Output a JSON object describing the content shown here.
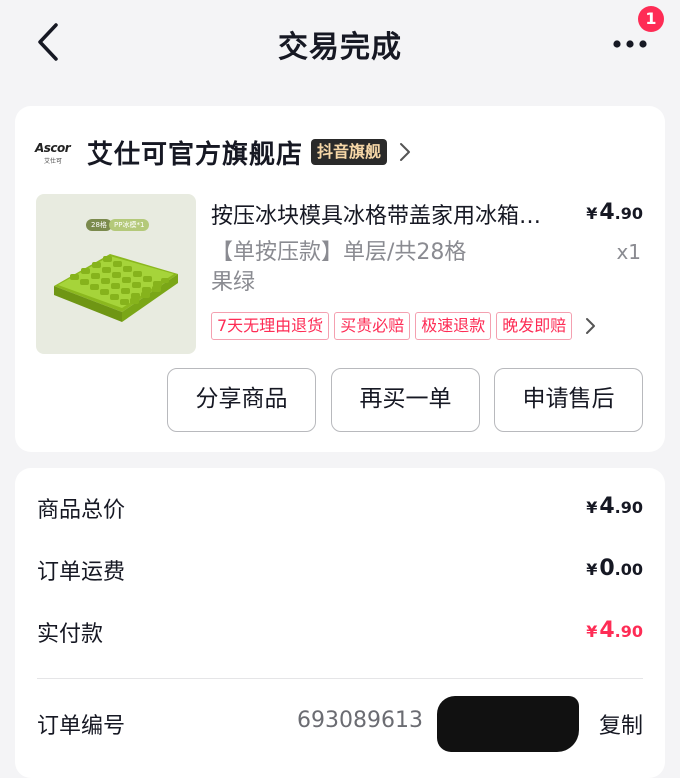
{
  "header": {
    "title": "交易完成",
    "notification_count": "1",
    "icons": [
      "back-arrow-icon",
      "more-dots-icon"
    ]
  },
  "shop": {
    "logo_text": "Ascor",
    "logo_subtext": "艾仕可",
    "name": "艾仕可官方旗舰店",
    "tag": "抖音旗舰"
  },
  "product": {
    "image_labels": [
      "28格",
      "PP冰模*1"
    ],
    "title": "按压冰块模具冰格带盖家用冰箱冻冰块",
    "price_yen": "¥",
    "price_int": "4",
    "price_frac": ".90",
    "spec_line1": "【单按压款】单层/共28格",
    "spec_line2": "果绿",
    "quantity": "x1",
    "service_tags": [
      "7天无理由退货",
      "买贵必赔",
      "极速退款",
      "晚发即赔"
    ]
  },
  "actions": {
    "share": "分享商品",
    "rebuy": "再买一单",
    "after_sale": "申请售后"
  },
  "summary": {
    "total_label": "商品总价",
    "total": {
      "yen": "¥",
      "int": "4",
      "frac": ".90"
    },
    "shipping_label": "订单运费",
    "shipping": {
      "yen": "¥",
      "int": "0",
      "frac": ".00"
    },
    "paid_label": "实付款",
    "paid": {
      "yen": "¥",
      "int": "4",
      "frac": ".90"
    },
    "order_no_label": "订单编号",
    "order_no_visible": "693089613",
    "copy_label": "复制"
  },
  "colors": {
    "accent": "#fe2c55",
    "background": "#f4f4f6",
    "card": "#ffffff",
    "product_green": "#9ccc2c"
  }
}
